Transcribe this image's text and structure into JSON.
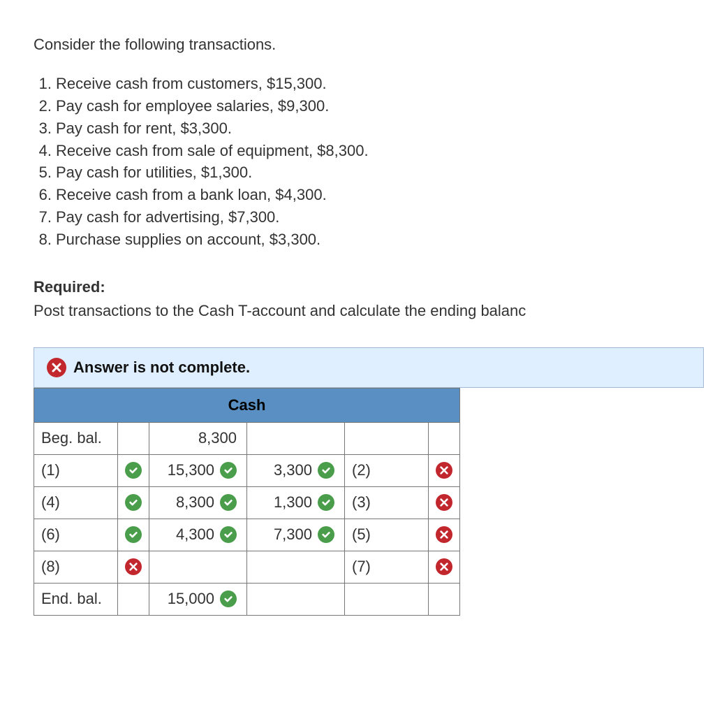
{
  "intro": "Consider the following transactions.",
  "transactions": [
    {
      "n": "1.",
      "text": "Receive cash from customers, $15,300."
    },
    {
      "n": "2.",
      "text": "Pay cash for employee salaries, $9,300."
    },
    {
      "n": "3.",
      "text": "Pay cash for rent, $3,300."
    },
    {
      "n": "4.",
      "text": "Receive cash from sale of equipment, $8,300."
    },
    {
      "n": "5.",
      "text": "Pay cash for utilities, $1,300."
    },
    {
      "n": "6.",
      "text": "Receive cash from a bank loan, $4,300."
    },
    {
      "n": "7.",
      "text": "Pay cash for advertising, $7,300."
    },
    {
      "n": "8.",
      "text": "Purchase supplies on account, $3,300."
    }
  ],
  "required_label": "Required:",
  "required_text": "Post transactions to the Cash T-account and calculate the ending balanc",
  "alert": "Answer is not complete.",
  "account_title": "Cash",
  "rows": {
    "beg": {
      "label": "Beg. bal.",
      "debit_amt": "8,300"
    },
    "r1": {
      "debit_label": "(1)",
      "debit_label_ok": true,
      "debit_amt": "15,300",
      "debit_amt_ok": true,
      "credit_amt": "3,300",
      "credit_amt_ok": true,
      "credit_label": "(2)",
      "credit_label_ok": false
    },
    "r2": {
      "debit_label": "(4)",
      "debit_label_ok": true,
      "debit_amt": "8,300",
      "debit_amt_ok": true,
      "credit_amt": "1,300",
      "credit_amt_ok": true,
      "credit_label": "(3)",
      "credit_label_ok": false
    },
    "r3": {
      "debit_label": "(6)",
      "debit_label_ok": true,
      "debit_amt": "4,300",
      "debit_amt_ok": true,
      "credit_amt": "7,300",
      "credit_amt_ok": true,
      "credit_label": "(5)",
      "credit_label_ok": false
    },
    "r4": {
      "debit_label": "(8)",
      "debit_label_ok": false,
      "credit_label": "(7)",
      "credit_label_ok": false
    },
    "end": {
      "label": "End. bal.",
      "debit_amt": "15,000",
      "debit_amt_ok": true
    }
  }
}
